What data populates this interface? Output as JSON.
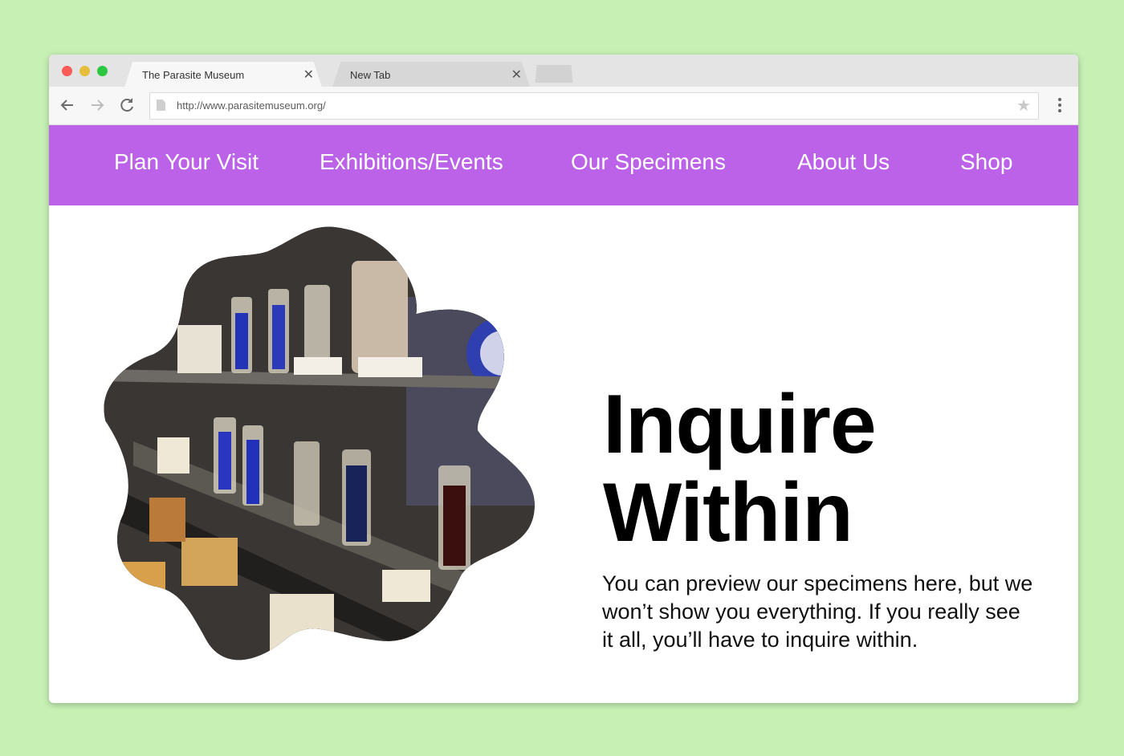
{
  "browser": {
    "tabs": [
      {
        "label": "The Parasite Museum",
        "active": true
      },
      {
        "label": "New Tab",
        "active": false
      }
    ],
    "url": "http://www.parasitemuseum.org/",
    "icons": {
      "back": "arrow-left-icon",
      "forward": "arrow-right-icon",
      "reload": "reload-icon",
      "bookmark": "star-icon",
      "menu": "vertical-dots-icon"
    }
  },
  "site": {
    "accent_color": "#bb62e8",
    "nav": [
      "Plan Your Visit",
      "Exhibitions/Events",
      "Our Specimens",
      "About Us",
      "Shop"
    ],
    "hero": {
      "headline_line1": "Inquire",
      "headline_line2": "Within",
      "intro": "You can preview our specimens here, but we won’t show you everything. If you  really see it all, you’ll have to inquire within."
    }
  }
}
